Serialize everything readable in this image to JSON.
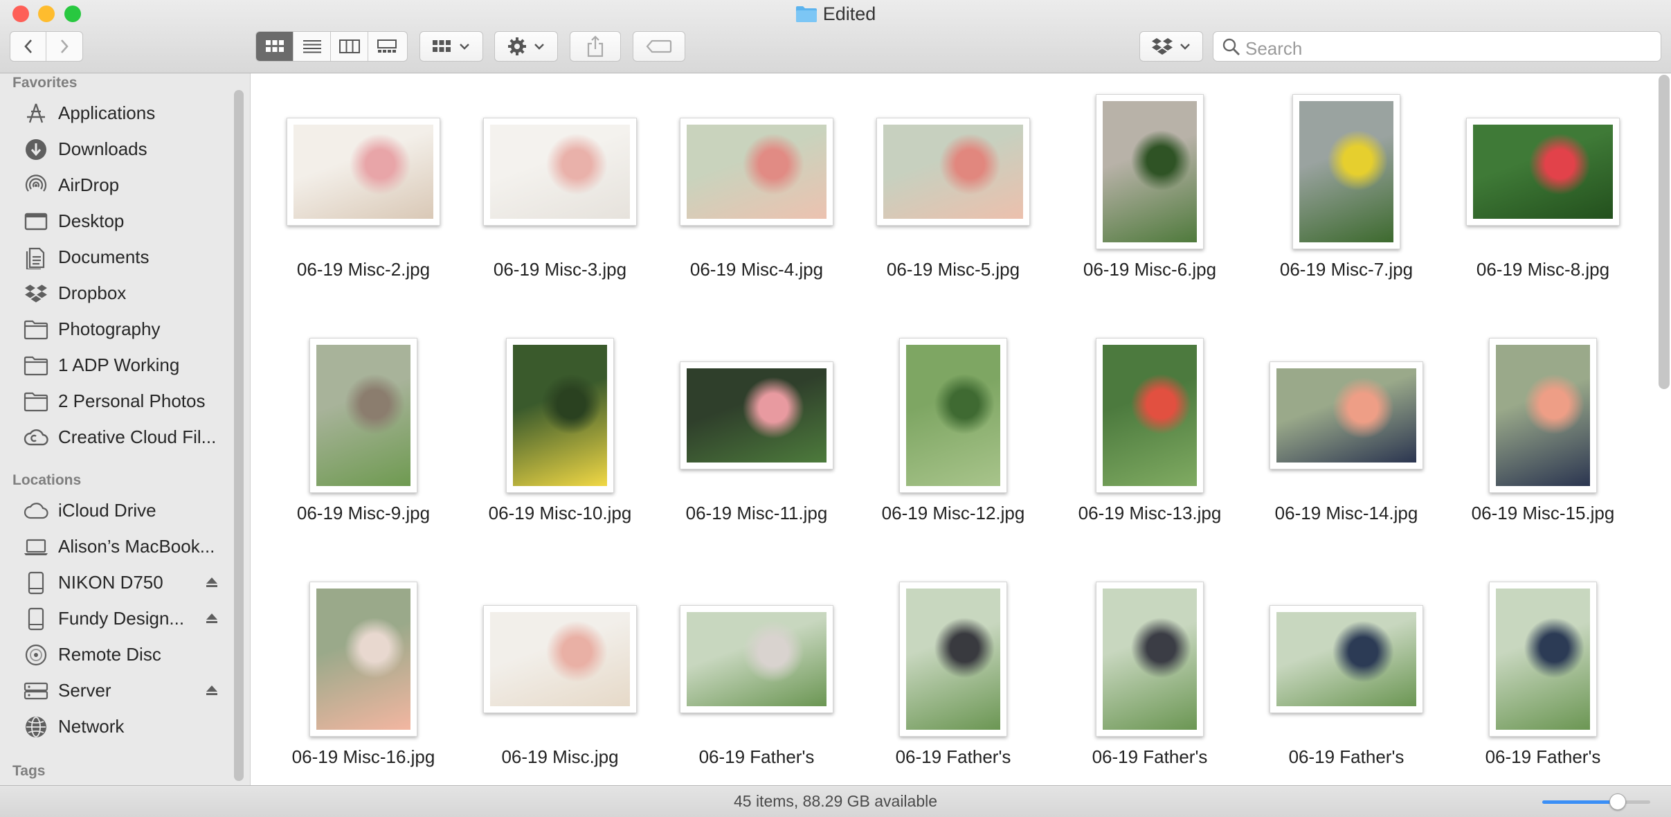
{
  "window": {
    "title": "Edited"
  },
  "toolbar": {
    "back_icon": "chevron-left",
    "forward_icon": "chevron-right",
    "view_modes": [
      "icon-view",
      "list-view",
      "column-view",
      "gallery-view"
    ],
    "selected_view": "icon-view",
    "search_placeholder": "Search"
  },
  "sidebar": {
    "favorites_header": "Favorites",
    "favorites": [
      {
        "label": "Applications",
        "icon": "applications-icon"
      },
      {
        "label": "Downloads",
        "icon": "downloads-icon"
      },
      {
        "label": "AirDrop",
        "icon": "airdrop-icon"
      },
      {
        "label": "Desktop",
        "icon": "desktop-icon"
      },
      {
        "label": "Documents",
        "icon": "documents-icon"
      },
      {
        "label": "Dropbox",
        "icon": "dropbox-icon"
      },
      {
        "label": "Photography",
        "icon": "folder-icon"
      },
      {
        "label": "1 ADP Working",
        "icon": "folder-icon"
      },
      {
        "label": "2 Personal Photos",
        "icon": "folder-icon"
      },
      {
        "label": "Creative Cloud Fil...",
        "icon": "creative-cloud-icon"
      }
    ],
    "locations_header": "Locations",
    "locations": [
      {
        "label": "iCloud Drive",
        "icon": "icloud-icon",
        "eject": false
      },
      {
        "label": "Alison’s MacBook...",
        "icon": "laptop-icon",
        "eject": false
      },
      {
        "label": "NIKON D750",
        "icon": "drive-icon",
        "eject": true
      },
      {
        "label": "Fundy Design...",
        "icon": "drive-icon",
        "eject": true
      },
      {
        "label": "Remote Disc",
        "icon": "disc-icon",
        "eject": false
      },
      {
        "label": "Server",
        "icon": "server-icon",
        "eject": true
      },
      {
        "label": "Network",
        "icon": "network-icon",
        "eject": false
      }
    ],
    "tags_header": "Tags"
  },
  "files": [
    {
      "name": "06-19 Misc-2.jpg",
      "orientation": "landscape",
      "palette": [
        "#f3efe9",
        "#d9c8b6",
        "#e8a5a8"
      ]
    },
    {
      "name": "06-19 Misc-3.jpg",
      "orientation": "landscape",
      "palette": [
        "#f4f2ee",
        "#e6e2dc",
        "#e9b1aa"
      ]
    },
    {
      "name": "06-19 Misc-4.jpg",
      "orientation": "landscape",
      "palette": [
        "#c9d3bd",
        "#ecc2b0",
        "#e18b84"
      ]
    },
    {
      "name": "06-19 Misc-5.jpg",
      "orientation": "landscape",
      "palette": [
        "#c7d0bf",
        "#ecc0ad",
        "#e1877e"
      ]
    },
    {
      "name": "06-19 Misc-6.jpg",
      "orientation": "portrait",
      "palette": [
        "#b8b2a8",
        "#4f7a3c",
        "#2f5325"
      ]
    },
    {
      "name": "06-19 Misc-7.jpg",
      "orientation": "portrait",
      "palette": [
        "#9aa3a0",
        "#3d6a2e",
        "#e6cf2e"
      ]
    },
    {
      "name": "06-19 Misc-8.jpg",
      "orientation": "landscape",
      "palette": [
        "#3f7a37",
        "#23501d",
        "#e2424a"
      ]
    },
    {
      "name": "06-19 Misc-9.jpg",
      "orientation": "portrait",
      "palette": [
        "#a8b39a",
        "#6e9a50",
        "#8b7d6e"
      ]
    },
    {
      "name": "06-19 Misc-10.jpg",
      "orientation": "portrait",
      "palette": [
        "#3a5a2c",
        "#f1d845",
        "#2a4120"
      ]
    },
    {
      "name": "06-19 Misc-11.jpg",
      "orientation": "landscape",
      "palette": [
        "#2f3f2b",
        "#4d7b3c",
        "#e89aa0"
      ]
    },
    {
      "name": "06-19 Misc-12.jpg",
      "orientation": "portrait",
      "palette": [
        "#7ea663",
        "#a8c48b",
        "#3f6a32"
      ]
    },
    {
      "name": "06-19 Misc-13.jpg",
      "orientation": "portrait",
      "palette": [
        "#4c7a3e",
        "#80ab62",
        "#e25040"
      ]
    },
    {
      "name": "06-19 Misc-14.jpg",
      "orientation": "landscape",
      "palette": [
        "#9aa98a",
        "#2b3550",
        "#ee9e86"
      ]
    },
    {
      "name": "06-19 Misc-15.jpg",
      "orientation": "portrait",
      "palette": [
        "#9aa98a",
        "#2b3550",
        "#ee9e86"
      ]
    },
    {
      "name": "06-19 Misc-16.jpg",
      "orientation": "portrait",
      "palette": [
        "#9aa98a",
        "#f3b6a1",
        "#e8d8cf"
      ]
    },
    {
      "name": "06-19 Misc.jpg",
      "orientation": "landscape",
      "palette": [
        "#f2efea",
        "#e6d9c8",
        "#e9b0a5"
      ]
    },
    {
      "name": "06-19 Father's",
      "orientation": "landscape",
      "palette": [
        "#c8d7bf",
        "#6b9653",
        "#d9d3cf"
      ]
    },
    {
      "name": "06-19 Father's",
      "orientation": "portrait",
      "palette": [
        "#c8d7bf",
        "#6b9653",
        "#393a3f"
      ]
    },
    {
      "name": "06-19 Father's",
      "orientation": "portrait",
      "palette": [
        "#c8d7bf",
        "#6b9653",
        "#3b3d45"
      ]
    },
    {
      "name": "06-19 Father's",
      "orientation": "landscape",
      "palette": [
        "#c8d7bf",
        "#6b9653",
        "#2c3b55"
      ]
    },
    {
      "name": "06-19 Father's",
      "orientation": "portrait",
      "palette": [
        "#c8d7bf",
        "#6b9653",
        "#2c3b55"
      ]
    }
  ],
  "status": {
    "text": "45 items, 88.29 GB available",
    "icon_size_level": 0.7
  },
  "colors": {
    "accent": "#3b8ff6",
    "close": "#fe5f57",
    "minimize": "#febc2e",
    "zoom": "#28c840",
    "folder": "#5bb3ee"
  }
}
